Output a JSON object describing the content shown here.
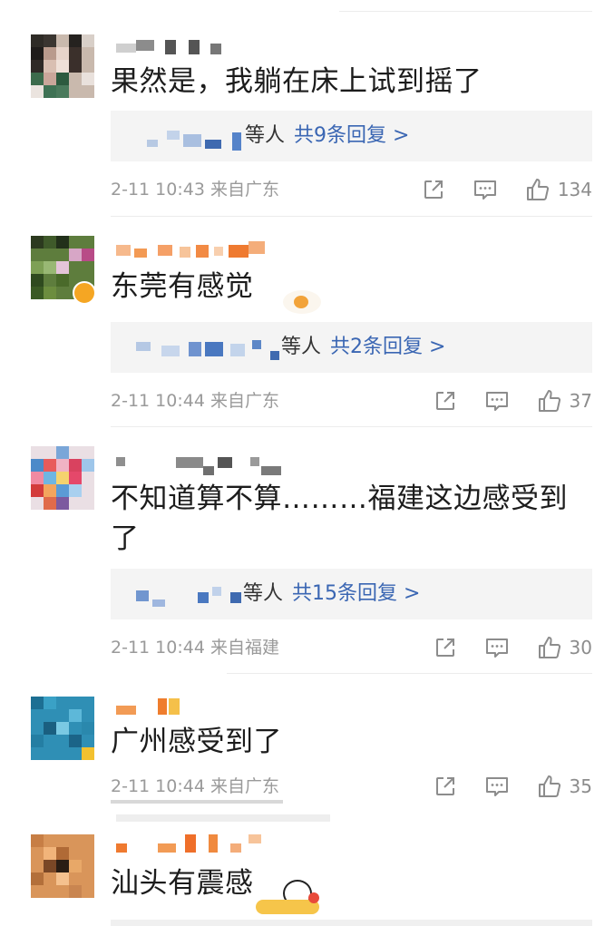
{
  "comments": [
    {
      "text": "果然是，我躺在床上试到摇了",
      "reply_suffix": "等人",
      "reply_total": "共9条回复 >",
      "time": "2-11 10:43",
      "location": "来自广东",
      "likes": "134"
    },
    {
      "text": "东莞有感觉",
      "reply_suffix": "等人",
      "reply_total": "共2条回复 >",
      "time": "2-11 10:44",
      "location": "来自广东",
      "likes": "37"
    },
    {
      "text": "不知道算不算………福建这边感受到了",
      "reply_suffix": "等人",
      "reply_total": "共15条回复 >",
      "time": "2-11 10:44",
      "location": "来自福建",
      "likes": "30"
    },
    {
      "text": "广州感受到了",
      "time": "2-11 10:44",
      "location": "来自广东",
      "likes": "35"
    },
    {
      "text": "汕头有震感"
    }
  ],
  "icons": {
    "share": "share-icon",
    "comment": "comment-icon",
    "like": "thumbs-up-icon"
  },
  "colors": {
    "link": "#3a66b3",
    "meta": "#9a9a9a",
    "reply_bg": "#f4f4f4"
  }
}
